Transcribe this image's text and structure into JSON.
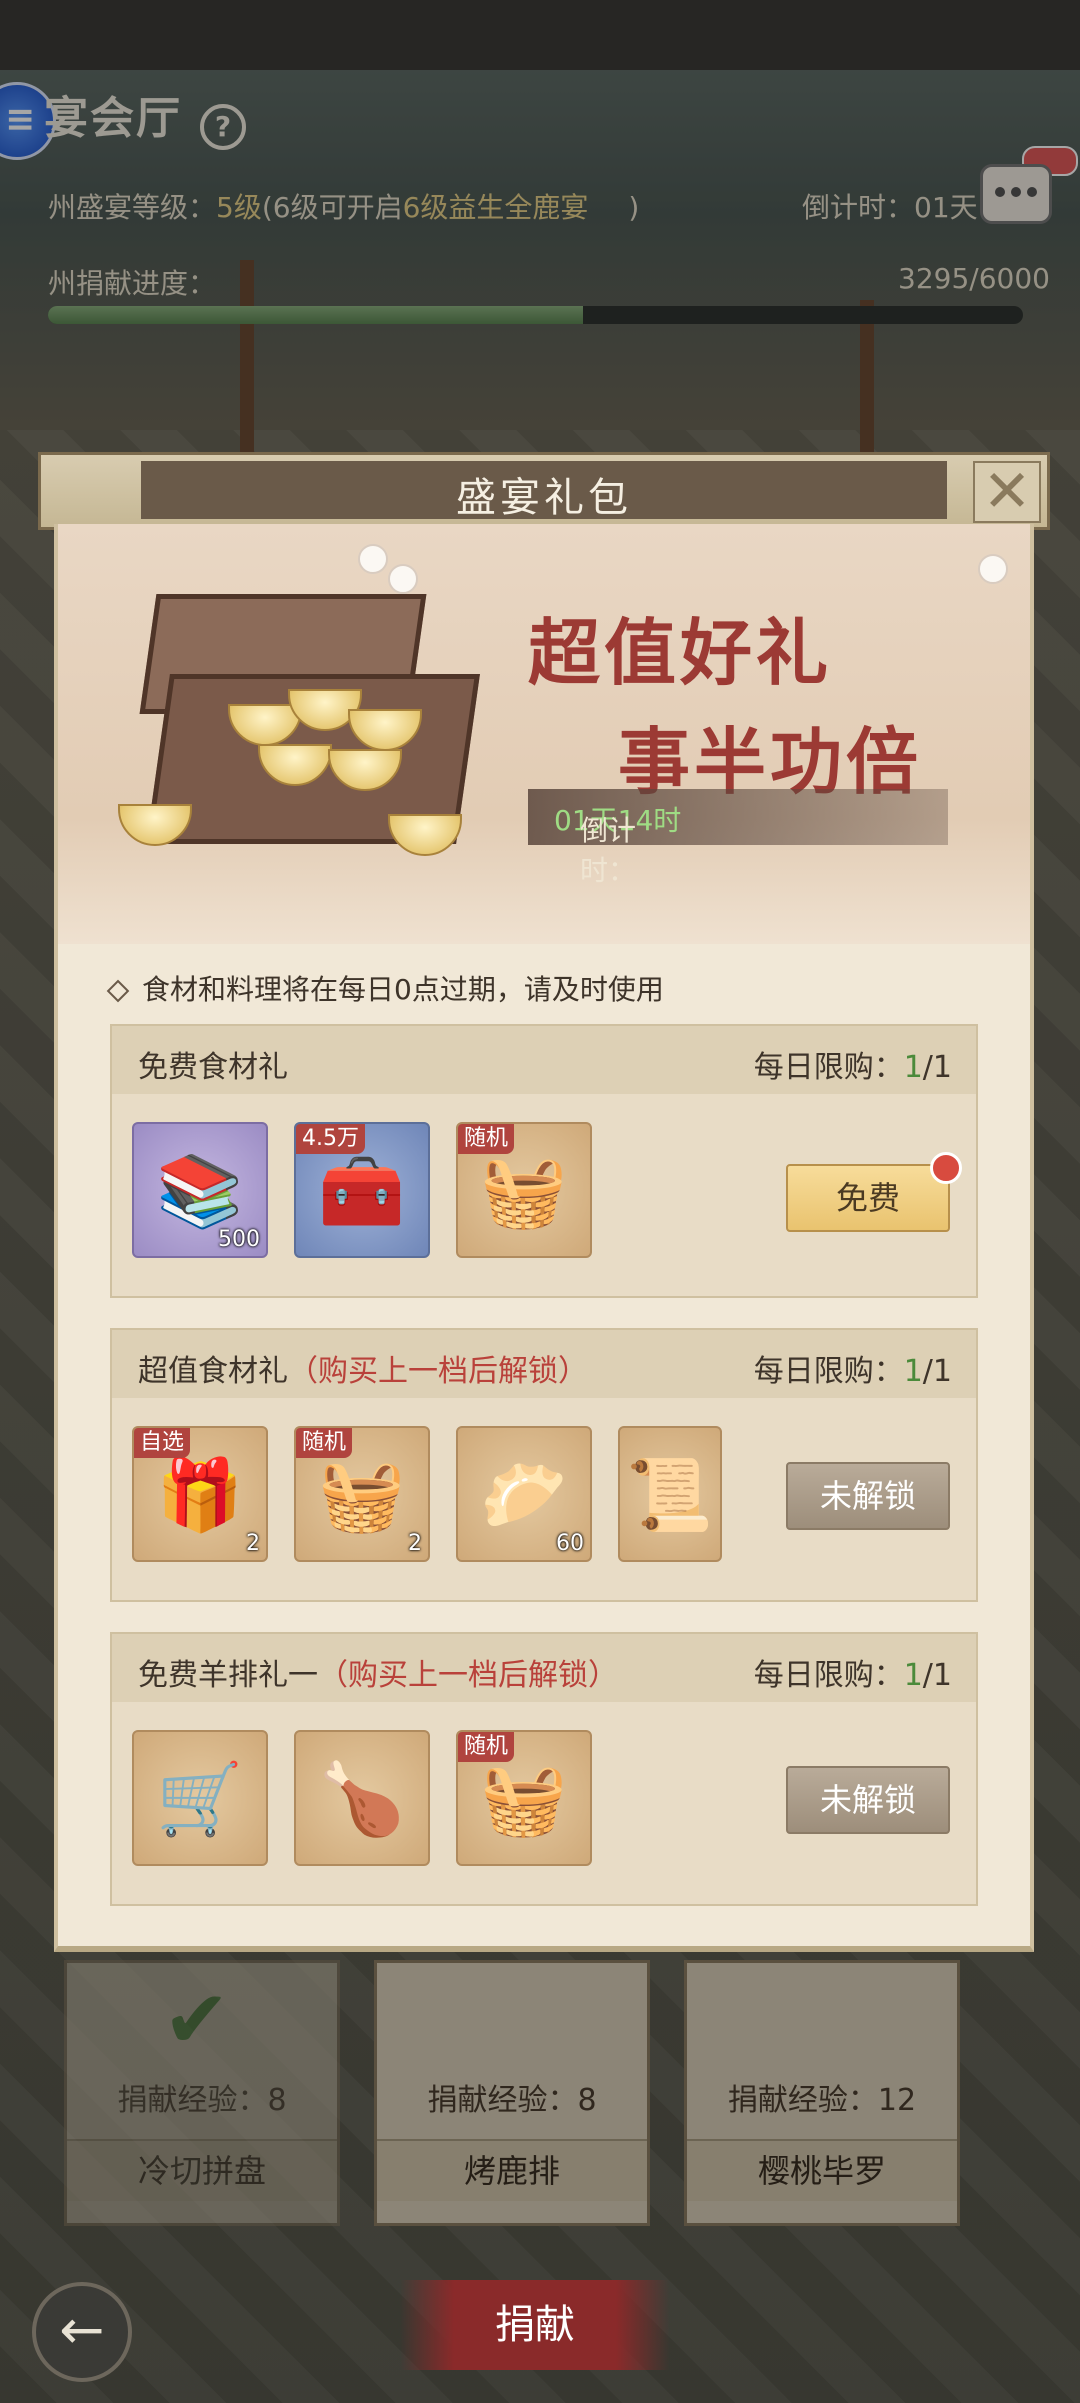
{
  "hud": {
    "title": "宴会厅",
    "help": "?",
    "level_label": "州盛宴等级：",
    "level_value": "5级",
    "level_hint_open": "(6级可开启",
    "level_hint_value": "6级益生全鹿宴",
    "level_hint_close": ")",
    "timer_label": "倒计时：01天",
    "progress_label": "州捐献进度：",
    "progress_text": "3295/6000",
    "progress_ratio": 0.549
  },
  "modal": {
    "title": "盛宴礼包",
    "close": "✕",
    "banner": {
      "slogan_line1": "超值好礼",
      "slogan_line2": "事半功倍",
      "countdown_label": "倒计时：",
      "countdown_value": "01天14时"
    },
    "notice": "食材和料理将在每日0点过期，请及时使用",
    "sections": [
      {
        "name": "免费食材礼",
        "lock_note": "",
        "limit_label": "每日限购：",
        "limit_used": "1",
        "limit_total": "/1",
        "button": "免费",
        "items": [
          {
            "tag": "",
            "count": "500",
            "icon": "book-icon"
          },
          {
            "tag": "4.5万",
            "count": "",
            "icon": "silver-chest-icon"
          },
          {
            "tag": "随机",
            "count": "",
            "icon": "basket-icon"
          }
        ]
      },
      {
        "name": "超值食材礼",
        "lock_note": "（购买上一档后解锁）",
        "limit_label": "每日限购：",
        "limit_used": "1",
        "limit_total": "/1",
        "button": "未解锁",
        "items": [
          {
            "tag": "自选",
            "count": "2",
            "icon": "food-box-icon"
          },
          {
            "tag": "随机",
            "count": "2",
            "icon": "basket-icon"
          },
          {
            "tag": "",
            "count": "60",
            "icon": "gold-ingot-icon"
          },
          {
            "tag": "",
            "count": "",
            "icon": "scroll-book-icon"
          }
        ]
      },
      {
        "name": "免费羊排礼一",
        "lock_note": "（购买上一档后解锁）",
        "limit_label": "每日限购：",
        "limit_used": "1",
        "limit_total": "/1",
        "button": "未解锁",
        "items": [
          {
            "tag": "",
            "count": "",
            "icon": "cart-icon"
          },
          {
            "tag": "",
            "count": "",
            "icon": "roast-dish-icon"
          },
          {
            "tag": "随机",
            "count": "",
            "icon": "basket-icon"
          }
        ]
      }
    ]
  },
  "bottom": {
    "cards": [
      {
        "exp": "捐献经验：8",
        "name": "冷切拼盘"
      },
      {
        "exp": "捐献经验：8",
        "name": "烤鹿排"
      },
      {
        "exp": "捐献经验：12",
        "name": "樱桃毕罗"
      }
    ],
    "donate": "捐献",
    "back": "←"
  }
}
